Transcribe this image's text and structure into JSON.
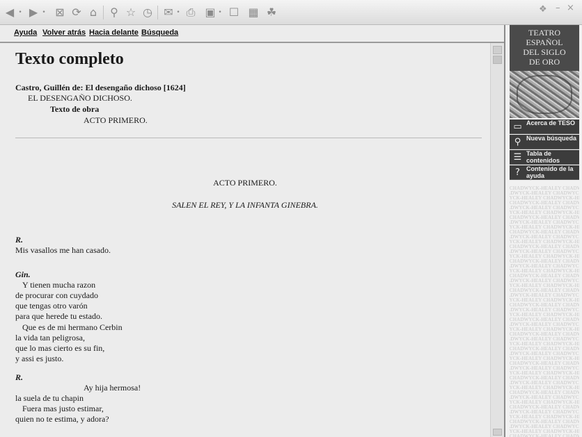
{
  "nav": {
    "links": [
      "Ayuda",
      "Volver atrás",
      "Hacia delante",
      "Búsqueda"
    ]
  },
  "document": {
    "title": "Texto completo",
    "citation": "Castro, Guillén de: El desengaño dichoso [1624]",
    "play_title": "EL DESENGAÑO DICHOSO.",
    "text_type": "Texto de obra",
    "act_toc": "ACTO PRIMERO.",
    "act_heading": "ACTO PRIMERO.",
    "stage_direction": "SALEN EL REY, Y LA INFANTA GINEBRA.",
    "speeches": [
      {
        "speaker": "R.",
        "lines": [
          "Mis vasallos me han casado."
        ]
      },
      {
        "speaker": "Gin.",
        "lines": [
          "Y tienen mucha razon",
          "de procurar con cuydado",
          "que tengas otro varón",
          "para que herede tu estado.",
          "Que es de mi hermano Cerbin",
          "la vida tan peligrosa,",
          "que lo mas cierto es su fin,",
          "y assi es justo."
        ]
      },
      {
        "speaker": "R.",
        "lines": [
          "Ay hija hermosa!",
          "la suela de tu chapin",
          "Fuera mas justo estimar,",
          "quien no te estima, y adora?"
        ]
      }
    ]
  },
  "sidebar": {
    "brand_lines": [
      "TEATRO",
      "ESPAÑOL",
      "DEL SIGLO",
      "DE ORO"
    ],
    "buttons": [
      {
        "label": "Acerca de TESO",
        "icon": "book-icon"
      },
      {
        "label": "Nueva búsqueda",
        "icon": "magnifier-icon"
      },
      {
        "label": "Tabla de contenidos",
        "icon": "list-icon"
      },
      {
        "label": "Contenido de la ayuda",
        "icon": "help-icon"
      }
    ],
    "watermark_text": "CHADWYCK-HEALEY"
  }
}
